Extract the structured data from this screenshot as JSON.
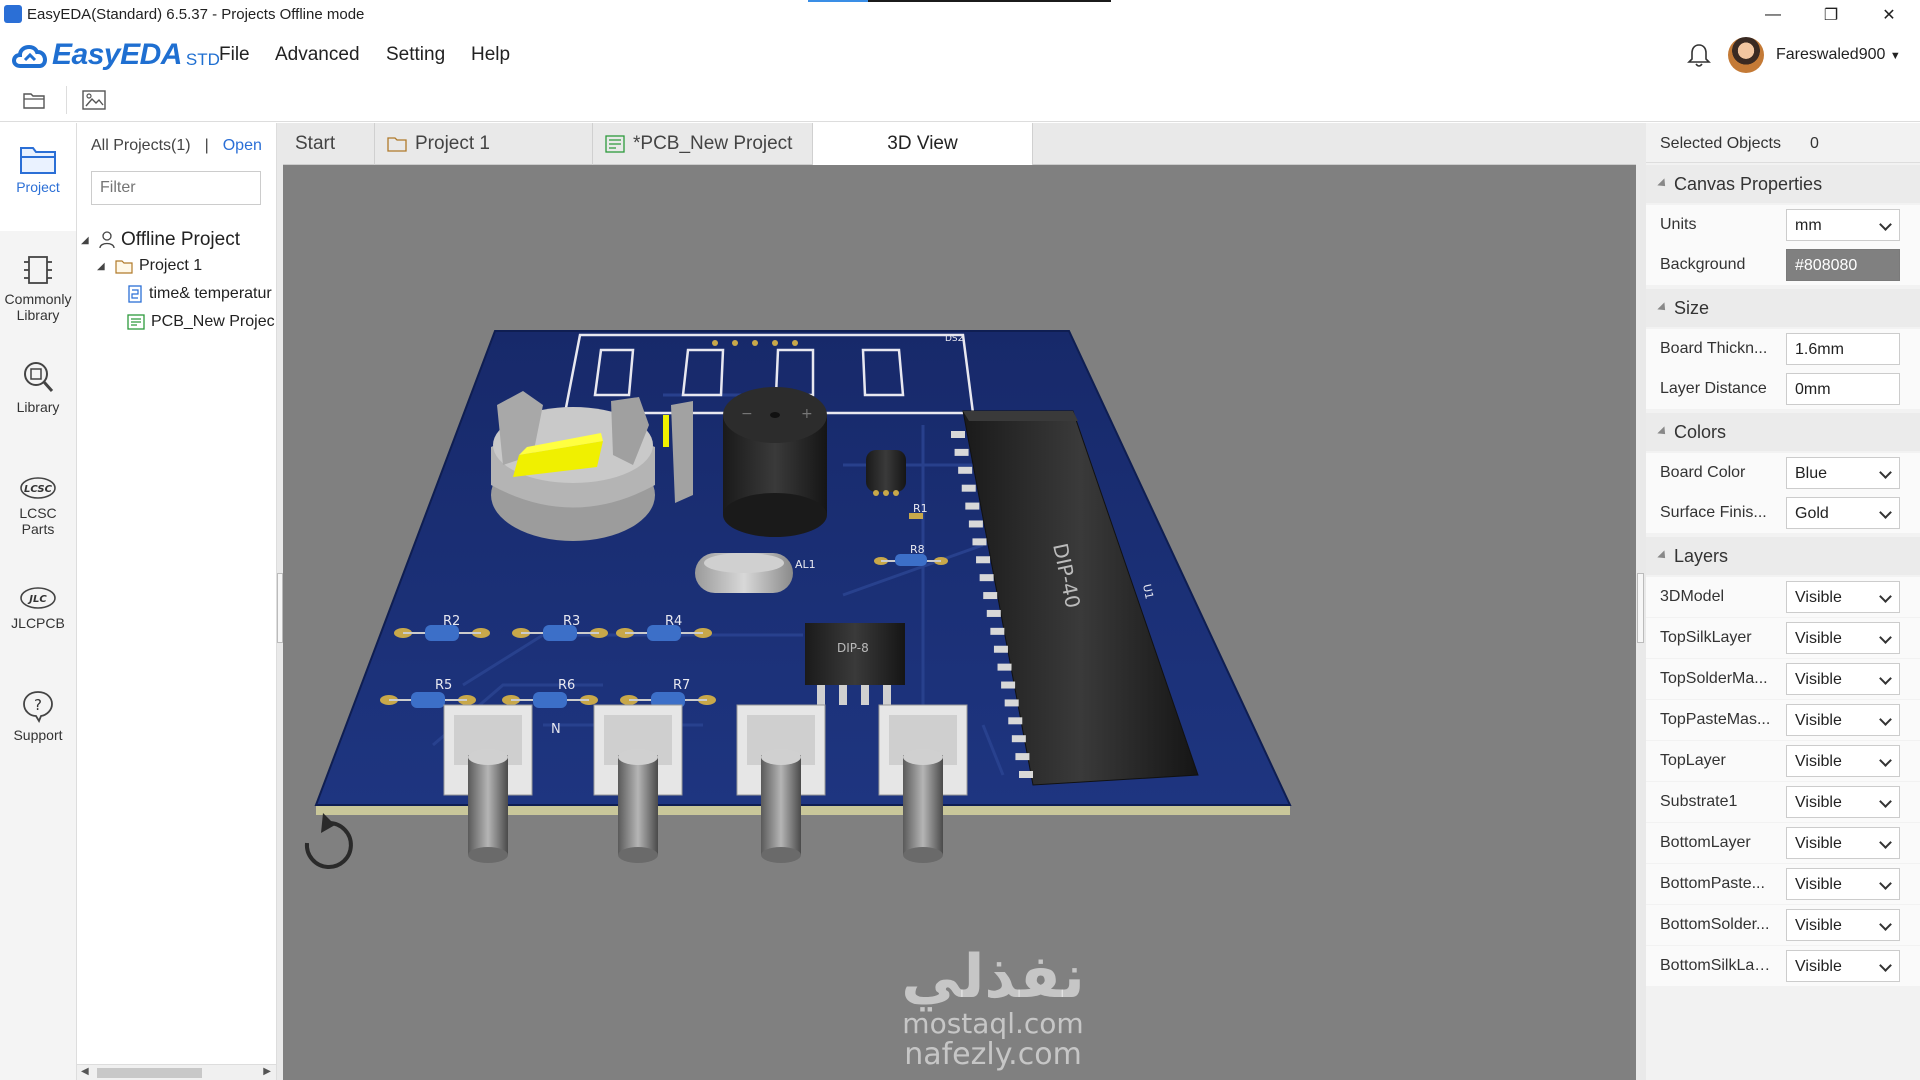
{
  "window": {
    "title": "EasyEDA(Standard) 6.5.37 - Projects Offline mode",
    "minimize": "—",
    "restore": "❐",
    "close": "✕"
  },
  "menubar": {
    "brand": "EasyEDA",
    "brand_suffix": "STD",
    "items": [
      "File",
      "Advanced",
      "Setting",
      "Help"
    ],
    "username": "Fareswaled900"
  },
  "leftnav": {
    "items": [
      {
        "label": "Project",
        "icon": "folder-icon"
      },
      {
        "label": "Commonly Library",
        "icon": "chip-icon"
      },
      {
        "label": "Library",
        "icon": "magnifier-icon"
      },
      {
        "label": "LCSC Parts",
        "icon": "lcsc-icon"
      },
      {
        "label": "JLCPCB",
        "icon": "jlcpcb-icon"
      },
      {
        "label": "Support",
        "icon": "help-icon"
      }
    ]
  },
  "project_panel": {
    "all_projects": "All Projects(1)",
    "separator": "|",
    "open": "Open",
    "filter_placeholder": "Filter",
    "tree": {
      "root": "Offline Project",
      "project": "Project 1",
      "files": [
        "time& temperatur",
        "PCB_New Projec"
      ]
    }
  },
  "tabs": [
    {
      "label": "Start"
    },
    {
      "label": "Project 1"
    },
    {
      "label": "*PCB_New Project"
    },
    {
      "label": "3D View"
    }
  ],
  "scene": {
    "labels": {
      "ds2": "DS2",
      "r1": "R1",
      "r8": "R8",
      "al1": "AL1",
      "dip40": "DIP-40",
      "u1": "U1",
      "dip8": "DIP-8",
      "r2": "R2",
      "r3": "R3",
      "r4": "R4",
      "r5": "R5",
      "r6": "R6",
      "r7": "R7",
      "n_mark": "N",
      "plus": "+",
      "minus": "−"
    },
    "board_color": "#1b2f6b",
    "background": "#808080"
  },
  "watermark": {
    "arabic": "نفذلي",
    "line1": "mostaql.com",
    "line2": "nafezly.com"
  },
  "properties": {
    "selected_label": "Selected Objects",
    "selected_count": "0",
    "canvas_properties": "Canvas Properties",
    "units_label": "Units",
    "units_value": "mm",
    "background_label": "Background",
    "background_value": "#808080",
    "size": "Size",
    "board_thickness_label": "Board Thickn...",
    "board_thickness_value": "1.6mm",
    "layer_distance_label": "Layer Distance",
    "layer_distance_value": "0mm",
    "colors": "Colors",
    "board_color_label": "Board Color",
    "board_color_value": "Blue",
    "surface_finish_label": "Surface Finis...",
    "surface_finish_value": "Gold",
    "layers": "Layers",
    "layer_rows": [
      {
        "label": "3DModel",
        "value": "Visible"
      },
      {
        "label": "TopSilkLayer",
        "value": "Visible"
      },
      {
        "label": "TopSolderMa...",
        "value": "Visible"
      },
      {
        "label": "TopPasteMas...",
        "value": "Visible"
      },
      {
        "label": "TopLayer",
        "value": "Visible"
      },
      {
        "label": "Substrate1",
        "value": "Visible"
      },
      {
        "label": "BottomLayer",
        "value": "Visible"
      },
      {
        "label": "BottomPaste...",
        "value": "Visible"
      },
      {
        "label": "BottomSolder...",
        "value": "Visible"
      },
      {
        "label": "BottomSilkLayer",
        "value": "Visible"
      }
    ]
  }
}
